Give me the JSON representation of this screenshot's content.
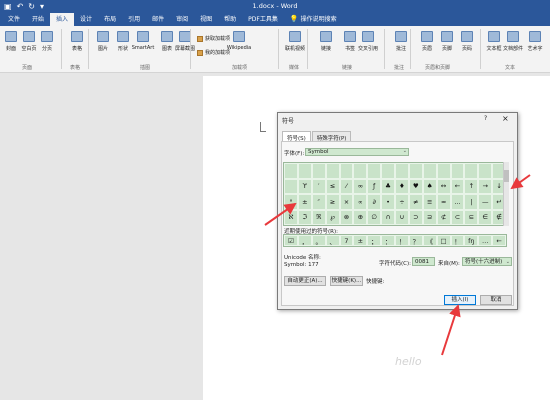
{
  "titlebar": {
    "title": "1.docx  -  Word",
    "undo_icon": "↶",
    "redo_icon": "↻",
    "save_icon": "▣",
    "more_icon": "▾"
  },
  "menu": {
    "tabs": [
      "文件",
      "开始",
      "插入",
      "设计",
      "布局",
      "引用",
      "邮件",
      "审阅",
      "视图",
      "帮助",
      "PDF工具集"
    ],
    "active": "插入",
    "search_icon": "💡",
    "search_label": "操作说明搜索"
  },
  "ribbon": {
    "buttons": [
      "封面",
      "空白页",
      "分页",
      "表格",
      "图片",
      "形状",
      "SmartArt",
      "图表",
      "屏幕截图",
      "Wikipedia",
      "联机视频",
      "链接",
      "书签",
      "交叉引用",
      "批注",
      "页眉",
      "页脚",
      "页码",
      "文本框",
      "文档部件",
      "艺术字"
    ],
    "addin_get": "获取加载项",
    "addin_mine": "我的加载项",
    "groups": [
      "页面",
      "表格",
      "插图",
      "加载项",
      "媒体",
      "链接",
      "批注",
      "页眉和页脚",
      "文本"
    ]
  },
  "dialog": {
    "title": "符号",
    "help": "?",
    "close": "×",
    "tabs": [
      "符号(S)",
      "特殊字符(P)"
    ],
    "font_label": "字体(F):",
    "font_value": "Symbol",
    "symbols": [
      "",
      "",
      "",
      "",
      "",
      "",
      "",
      "",
      "",
      "",
      "",
      "",
      "",
      "",
      "",
      "",
      "",
      "ϒ",
      "′",
      "≤",
      "⁄",
      "∞",
      "ƒ",
      "♣",
      "♦",
      "♥",
      "♠",
      "↔",
      "←",
      "↑",
      "→",
      "↓",
      "°",
      "±",
      "″",
      "≥",
      "×",
      "∝",
      "∂",
      "•",
      "÷",
      "≠",
      "≡",
      "≈",
      "…",
      "|",
      "—",
      "↵",
      "ℵ",
      "ℑ",
      "ℜ",
      "℘",
      "⊗",
      "⊕",
      "∅",
      "∩",
      "∪",
      "⊃",
      "⊇",
      "⊄",
      "⊂",
      "⊆",
      "∈",
      "∉"
    ],
    "selected_symbol": "±",
    "recent_label": "近期使用过的符号(R):",
    "recent": [
      "☑",
      "，",
      "。",
      "、",
      "7",
      "±",
      "；",
      "：",
      "！",
      "？",
      "《",
      "□",
      "！",
      "fŋ",
      "…",
      "←"
    ],
    "unicode_name_label": "Unicode 名称:",
    "unicode_name_value": "Symbol: 177",
    "code_label": "字符代码(C):",
    "code_value": "0081",
    "from_label": "来自(M):",
    "from_value": "符号(十六进制)",
    "autocorrect_btn": "自动更正(A)...",
    "shortcut_btn": "快捷键(K)...",
    "shortcut_label": "快捷键:",
    "insert_btn": "插入(I)",
    "cancel_btn": "取消"
  },
  "annotation_color": "#e8393c",
  "watermark": "hello"
}
